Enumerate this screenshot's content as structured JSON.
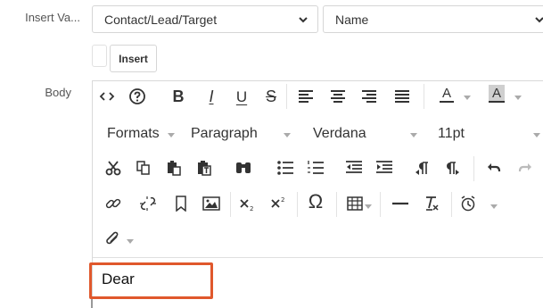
{
  "form": {
    "insert_variable_label": "Insert Va...",
    "body_label": "Body",
    "module_select": "Contact/Lead/Target",
    "field_select": "Name",
    "insert_button": "Insert"
  },
  "toolbar": {
    "formats_label": "Formats",
    "block_label": "Paragraph",
    "font_label": "Verdana",
    "size_label": "11pt",
    "bold_glyph": "B",
    "italic_glyph": "I",
    "underline_glyph": "U",
    "strike_glyph": "S",
    "text_color_glyph": "A",
    "bg_color_glyph": "A",
    "omega_glyph": "Ω"
  },
  "editor": {
    "body_text": "Dear"
  },
  "colors": {
    "highlight": "#e0582c",
    "border": "#d6d6d6"
  },
  "icons": [
    "source-code-icon",
    "help-icon",
    "bold-icon",
    "italic-icon",
    "underline-icon",
    "strikethrough-icon",
    "align-left-icon",
    "align-center-icon",
    "align-right-icon",
    "align-justify-icon",
    "text-color-icon",
    "background-color-icon",
    "cut-icon",
    "copy-icon",
    "paste-icon",
    "paste-text-icon",
    "find-icon",
    "bullet-list-icon",
    "numbered-list-icon",
    "outdent-icon",
    "indent-icon",
    "ltr-icon",
    "rtl-icon",
    "undo-icon",
    "redo-icon",
    "link-icon",
    "unlink-icon",
    "anchor-icon",
    "image-icon",
    "subscript-icon",
    "superscript-icon",
    "special-char-icon",
    "table-icon",
    "horizontal-rule-icon",
    "remove-format-icon",
    "insert-datetime-icon",
    "attachment-icon"
  ]
}
